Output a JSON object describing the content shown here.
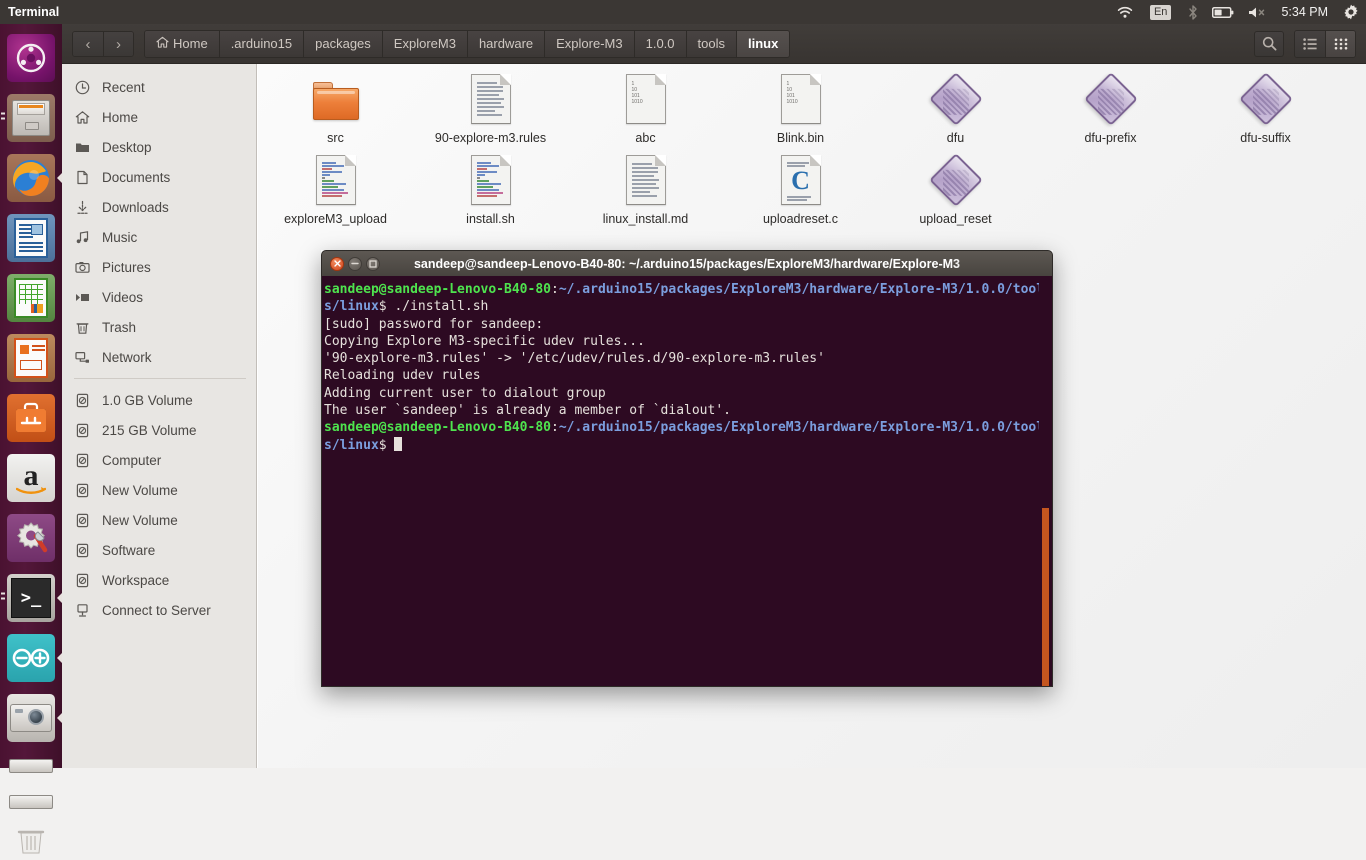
{
  "panel": {
    "title": "Terminal",
    "indicators": {
      "wifi": "wifi-icon",
      "keyboard": "En",
      "bluetooth": "bluetooth-icon",
      "battery": "battery-icon",
      "volume": "volume-muted-icon",
      "clock": "5:34 PM",
      "session": "gear-icon"
    }
  },
  "launcher": {
    "items": [
      {
        "name": "ubuntu-dash",
        "label": "Ubuntu Dash",
        "running": false,
        "focused": false
      },
      {
        "name": "files",
        "label": "Files",
        "running": true,
        "focused": false
      },
      {
        "name": "firefox",
        "label": "Firefox Web Browser",
        "running": false,
        "focused": false
      },
      {
        "name": "libreoffice-writer",
        "label": "LibreOffice Writer",
        "running": false,
        "focused": false
      },
      {
        "name": "libreoffice-calc",
        "label": "LibreOffice Calc",
        "running": false,
        "focused": false
      },
      {
        "name": "libreoffice-impress",
        "label": "LibreOffice Impress",
        "running": false,
        "focused": false
      },
      {
        "name": "ubuntu-software",
        "label": "Ubuntu Software",
        "running": false,
        "focused": false
      },
      {
        "name": "amazon",
        "label": "Amazon",
        "running": false,
        "focused": false
      },
      {
        "name": "system-settings",
        "label": "System Settings",
        "running": false,
        "focused": false
      },
      {
        "name": "terminal",
        "label": "Terminal",
        "running": true,
        "focused": true
      },
      {
        "name": "arduino",
        "label": "Arduino IDE",
        "running": true,
        "focused": false
      },
      {
        "name": "camera",
        "label": "Camera",
        "running": true,
        "focused": false
      },
      {
        "name": "volume-1",
        "label": "Volume",
        "running": false,
        "focused": false
      },
      {
        "name": "volume-2",
        "label": "Volume",
        "running": false,
        "focused": false
      },
      {
        "name": "trash",
        "label": "Trash",
        "running": false,
        "focused": false
      }
    ]
  },
  "file_manager": {
    "nav": {
      "back": "‹",
      "forward": "›"
    },
    "breadcrumbs": [
      {
        "label": "Home",
        "icon": "home-icon",
        "active": false
      },
      {
        "label": ".arduino15",
        "icon": null,
        "active": false
      },
      {
        "label": "packages",
        "icon": null,
        "active": false
      },
      {
        "label": "ExploreM3",
        "icon": null,
        "active": false
      },
      {
        "label": "hardware",
        "icon": null,
        "active": false
      },
      {
        "label": "Explore-M3",
        "icon": null,
        "active": false
      },
      {
        "label": "1.0.0",
        "icon": null,
        "active": false
      },
      {
        "label": "tools",
        "icon": null,
        "active": false
      },
      {
        "label": "linux",
        "icon": null,
        "active": true
      }
    ],
    "toolbar_right": [
      {
        "name": "search-icon",
        "label": "Search"
      },
      {
        "name": "list-view-icon",
        "label": "List view",
        "active": false
      },
      {
        "name": "grid-view-icon",
        "label": "Grid view",
        "active": true
      }
    ],
    "sidebar": [
      {
        "label": "Recent",
        "icon": "clock-icon"
      },
      {
        "label": "Home",
        "icon": "home-icon"
      },
      {
        "label": "Desktop",
        "icon": "folder-icon"
      },
      {
        "label": "Documents",
        "icon": "document-icon"
      },
      {
        "label": "Downloads",
        "icon": "download-icon"
      },
      {
        "label": "Music",
        "icon": "music-icon"
      },
      {
        "label": "Pictures",
        "icon": "camera-icon"
      },
      {
        "label": "Videos",
        "icon": "video-icon"
      },
      {
        "label": "Trash",
        "icon": "trash-icon"
      },
      {
        "label": "Network",
        "icon": "network-icon"
      },
      {
        "label": "1.0 GB Volume",
        "icon": "drive-icon"
      },
      {
        "label": "215 GB Volume",
        "icon": "drive-icon"
      },
      {
        "label": "Computer",
        "icon": "drive-icon"
      },
      {
        "label": "New Volume",
        "icon": "drive-icon"
      },
      {
        "label": "New Volume",
        "icon": "drive-icon"
      },
      {
        "label": "Software",
        "icon": "drive-icon"
      },
      {
        "label": "Workspace",
        "icon": "drive-icon"
      },
      {
        "label": "Connect to Server",
        "icon": "server-icon"
      }
    ],
    "files": [
      {
        "label": "src",
        "type": "folder"
      },
      {
        "label": "90-explore-m3.rules",
        "type": "text"
      },
      {
        "label": "abc",
        "type": "binary"
      },
      {
        "label": "Blink.bin",
        "type": "binary"
      },
      {
        "label": "dfu",
        "type": "executable"
      },
      {
        "label": "dfu-prefix",
        "type": "executable"
      },
      {
        "label": "dfu-suffix",
        "type": "executable"
      },
      {
        "label": "exploreM3_upload",
        "type": "script"
      },
      {
        "label": "install.sh",
        "type": "script"
      },
      {
        "label": "linux_install.md",
        "type": "text"
      },
      {
        "label": "uploadreset.c",
        "type": "csource"
      },
      {
        "label": "upload_reset",
        "type": "executable"
      }
    ]
  },
  "terminal": {
    "title": "sandeep@sandeep-Lenovo-B40-80: ~/.arduino15/packages/ExploreM3/hardware/Explore-M3",
    "window_buttons": {
      "close": "close-icon",
      "minimize": "minimize-icon",
      "maximize": "maximize-icon"
    },
    "lines": [
      [
        {
          "t": "sandeep@sandeep-Lenovo-B40-80",
          "c": "green"
        },
        {
          "t": ":",
          "c": "white"
        },
        {
          "t": "~/.arduino15/packages/ExploreM3/hardware/Explore-M3/1.0.0/tools/linux",
          "c": "blue"
        },
        {
          "t": "$ ./install.sh",
          "c": "white"
        }
      ],
      [
        {
          "t": "[sudo] password for sandeep:",
          "c": "white"
        }
      ],
      [
        {
          "t": "Copying Explore M3-specific udev rules...",
          "c": "white"
        }
      ],
      [
        {
          "t": "'90-explore-m3.rules' -> '/etc/udev/rules.d/90-explore-m3.rules'",
          "c": "white"
        }
      ],
      [
        {
          "t": "Reloading udev rules",
          "c": "white"
        }
      ],
      [
        {
          "t": "Adding current user to dialout group",
          "c": "white"
        }
      ],
      [
        {
          "t": "The user `sandeep' is already a member of `dialout'.",
          "c": "white"
        }
      ],
      [
        {
          "t": "sandeep@sandeep-Lenovo-B40-80",
          "c": "green"
        },
        {
          "t": ":",
          "c": "white"
        },
        {
          "t": "~/.arduino15/packages/ExploreM3/hardware/Explore-M3/1.0.0/tools/linux",
          "c": "blue"
        },
        {
          "t": "$ ",
          "c": "white"
        },
        {
          "t": "",
          "c": "cursor"
        }
      ]
    ]
  },
  "colors": {
    "terminal_bg": "#2d0a22",
    "panel_bg": "#3b3734",
    "launcher_bg": "#4a1231",
    "accent_orange": "#dd4814",
    "scrollbar": "#c4561f",
    "prompt_green": "#4ee44e",
    "path_blue": "#7b9ede"
  }
}
